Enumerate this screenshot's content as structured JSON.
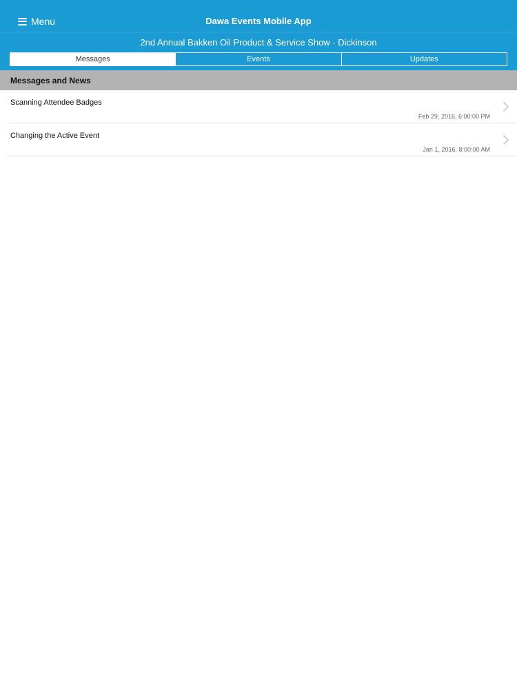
{
  "header": {
    "menu_label": "Menu",
    "app_title": "Dawa Events Mobile App",
    "event_name": "2nd Annual Bakken Oil Product & Service Show - Dickinson",
    "bar_color": "#1b9bd4"
  },
  "tabs": [
    {
      "label": "Messages",
      "active": true
    },
    {
      "label": "Events",
      "active": false
    },
    {
      "label": "Updates",
      "active": false
    }
  ],
  "section": {
    "title": "Messages and News"
  },
  "messages": [
    {
      "title": "Scanning Attendee Badges",
      "date": "Feb 29, 2016, 6:00:00 PM",
      "icon": "chevron-right-icon"
    },
    {
      "title": "Changing the Active Event",
      "date": "Jan 1, 2016, 8:00:00 AM",
      "icon": "chevron-right-icon"
    }
  ]
}
